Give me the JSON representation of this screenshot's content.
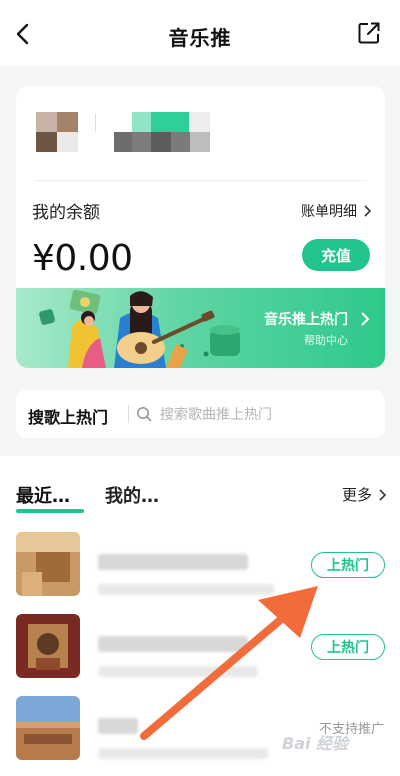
{
  "nav": {
    "title": "音乐推"
  },
  "account": {
    "balance_label": "我的余额",
    "bill_label": "账单明细",
    "balance_value": "¥0.00",
    "recharge_label": "充值"
  },
  "banner": {
    "title": "音乐推上热门",
    "subtitle": "帮助中心"
  },
  "search": {
    "label": "搜歌上热门",
    "placeholder": "搜索歌曲推上热门"
  },
  "tabs": {
    "recent": "最近…",
    "mine": "我的…",
    "more": "更多"
  },
  "songs": [
    {
      "button_label": "上热门"
    },
    {
      "button_label": "上热门"
    },
    {
      "status": "不支持推广"
    }
  ],
  "watermark": "Bai 经验",
  "colors": {
    "accent": "#21c48a",
    "banner_start": "#a8e9c9",
    "banner_end": "#2ec98a",
    "arrow": "#f26b3a"
  }
}
